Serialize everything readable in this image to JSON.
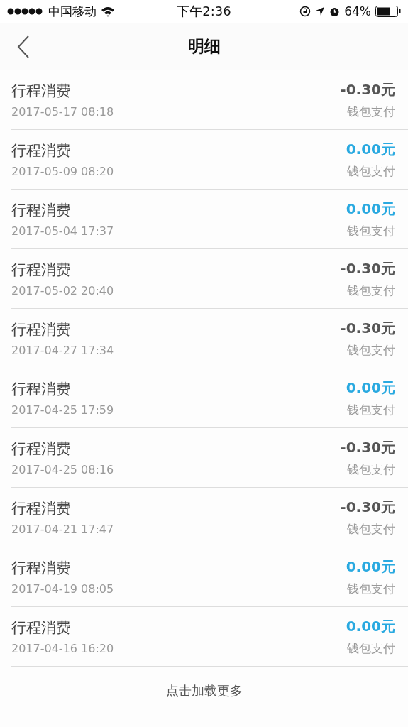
{
  "status_bar": {
    "carrier": "中国移动",
    "time": "下午2:36",
    "battery": "64%"
  },
  "nav": {
    "title": "明细"
  },
  "records": [
    {
      "title": "行程消费",
      "time": "2017-05-17 08:18",
      "amount": "-0.30元",
      "color": "#555555",
      "method": "钱包支付"
    },
    {
      "title": "行程消费",
      "time": "2017-05-09 08:20",
      "amount": "0.00元",
      "color": "#29a9e0",
      "method": "钱包支付"
    },
    {
      "title": "行程消费",
      "time": "2017-05-04 17:37",
      "amount": "0.00元",
      "color": "#29a9e0",
      "method": "钱包支付"
    },
    {
      "title": "行程消费",
      "time": "2017-05-02 20:40",
      "amount": "-0.30元",
      "color": "#555555",
      "method": "钱包支付"
    },
    {
      "title": "行程消费",
      "time": "2017-04-27 17:34",
      "amount": "-0.30元",
      "color": "#555555",
      "method": "钱包支付"
    },
    {
      "title": "行程消费",
      "time": "2017-04-25 17:59",
      "amount": "0.00元",
      "color": "#29a9e0",
      "method": "钱包支付"
    },
    {
      "title": "行程消费",
      "time": "2017-04-25 08:16",
      "amount": "-0.30元",
      "color": "#555555",
      "method": "钱包支付"
    },
    {
      "title": "行程消费",
      "time": "2017-04-21 17:47",
      "amount": "-0.30元",
      "color": "#555555",
      "method": "钱包支付"
    },
    {
      "title": "行程消费",
      "time": "2017-04-19 08:05",
      "amount": "0.00元",
      "color": "#29a9e0",
      "method": "钱包支付"
    },
    {
      "title": "行程消费",
      "time": "2017-04-16 16:20",
      "amount": "0.00元",
      "color": "#29a9e0",
      "method": "钱包支付"
    }
  ],
  "load_more": "点击加载更多"
}
